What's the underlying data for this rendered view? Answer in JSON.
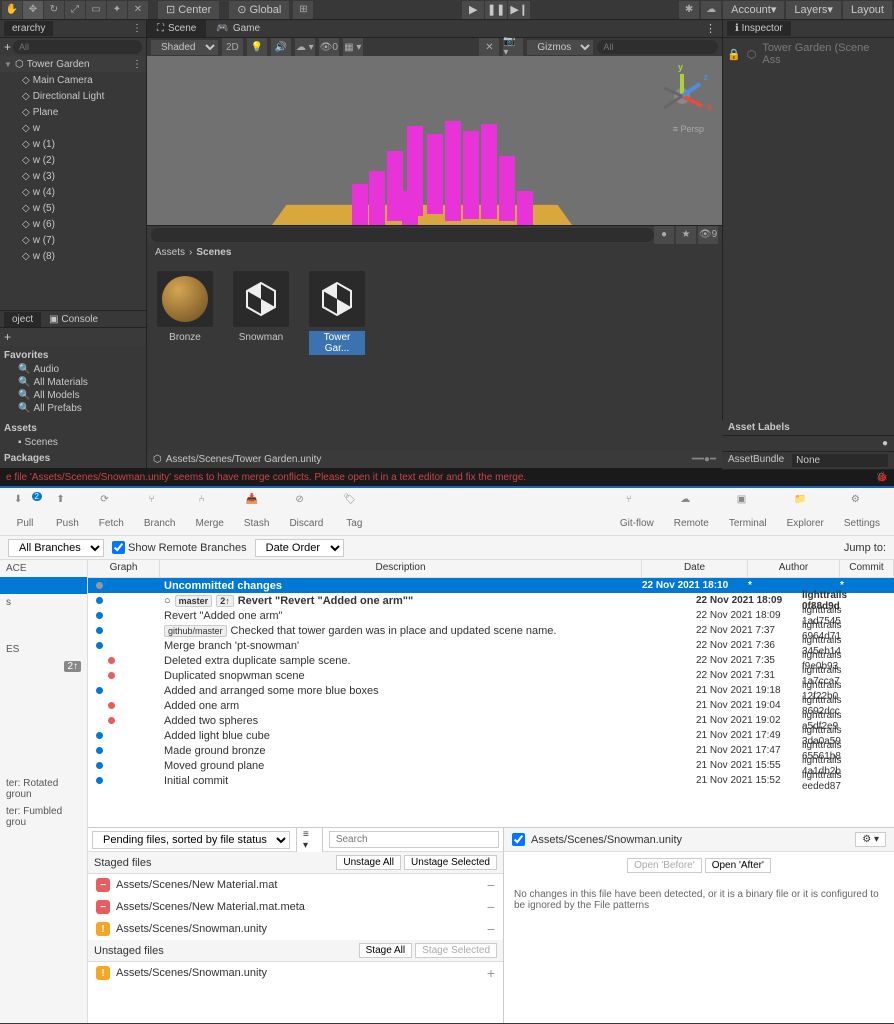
{
  "unity": {
    "toolbar": {
      "center": "Center",
      "global": "Global",
      "account": "Account",
      "layers": "Layers",
      "layout": "Layout"
    },
    "hierarchy": {
      "title": "erarchy",
      "search": "All",
      "root": "Tower Garden",
      "items": [
        "Main Camera",
        "Directional Light",
        "Plane",
        "w",
        "w (1)",
        "w (2)",
        "w (3)",
        "w (4)",
        "w (5)",
        "w (6)",
        "w (7)",
        "w (8)"
      ]
    },
    "tabs": {
      "scene": "Scene",
      "game": "Game"
    },
    "scene_toolbar": {
      "shaded": "Shaded",
      "mode2d": "2D",
      "gizmos": "Gizmos",
      "search": "All"
    },
    "gizmo": {
      "x": "x",
      "y": "y",
      "z": "z",
      "persp": "Persp"
    },
    "scene_path": "Assets/Scenes/Tower Garden.unity",
    "project": {
      "tab_project": "oject",
      "tab_console": "Console",
      "favorites": "Favorites",
      "fav_items": [
        "Audio",
        "All Materials",
        "All Models",
        "All Prefabs"
      ],
      "assets_header": "Assets",
      "scenes_item": "Scenes",
      "packages": "Packages",
      "breadcrumb_assets": "Assets",
      "breadcrumb_scenes": "Scenes",
      "counter": "9",
      "items": [
        {
          "name": "Bronze",
          "type": "material"
        },
        {
          "name": "Snowman",
          "type": "scene"
        },
        {
          "name": "Tower Gar...",
          "type": "scene",
          "selected": true
        }
      ]
    },
    "inspector": {
      "title": "Inspector",
      "asset_title": "Tower Garden (Scene Ass",
      "labels": "Asset Labels",
      "bundle": "AssetBundle",
      "bundle_val": "None"
    },
    "error": "e file 'Assets/Scenes/Snowman.unity' seems to have merge conflicts. Please open it in a text editor and fix the merge."
  },
  "sourcetree": {
    "toolbar": [
      {
        "label": "Pull",
        "badge": "2"
      },
      {
        "label": "Push"
      },
      {
        "label": "Fetch"
      },
      {
        "label": "Branch"
      },
      {
        "label": "Merge"
      },
      {
        "label": "Stash"
      },
      {
        "label": "Discard"
      },
      {
        "label": "Tag"
      }
    ],
    "toolbar_right": [
      "Git-flow",
      "Remote",
      "Terminal",
      "Explorer",
      "Settings"
    ],
    "filter": {
      "branches": "All Branches",
      "remote": "Show Remote Branches",
      "order": "Date Order",
      "jump": "Jump to:"
    },
    "sidebar": {
      "space": "ACE",
      "badge_item": "ES",
      "stash1": "ter: Rotated groun",
      "stash2": "ter: Fumbled grou"
    },
    "columns": {
      "graph": "Graph",
      "desc": "Description",
      "date": "Date",
      "author": "Author",
      "commit": "Commit"
    },
    "commits": [
      {
        "desc": "Uncommitted changes",
        "date": "22 Nov 2021 18:10",
        "author": "*",
        "commit": "*",
        "uncommitted": true
      },
      {
        "desc": "Revert \"Revert \"Added one arm\"\"",
        "tags": [
          "master",
          "2↑"
        ],
        "date": "22 Nov 2021 18:09",
        "author": "lighttrails <lightt",
        "commit": "0f88d9d",
        "bold": true,
        "head": true
      },
      {
        "desc": "Revert \"Added one arm\"",
        "date": "22 Nov 2021 18:09",
        "author": "lighttrails <lighttra",
        "commit": "1ad7545"
      },
      {
        "desc": "Checked that tower garden was in place and updated scene name.",
        "tags": [
          "github/master"
        ],
        "date": "22 Nov 2021 7:37",
        "author": "lighttrails <lighttra",
        "commit": "6964d71"
      },
      {
        "desc": "Merge branch 'pt-snowman'",
        "date": "22 Nov 2021 7:36",
        "author": "lighttrails <lighttra",
        "commit": "345eb14"
      },
      {
        "desc": "Deleted extra duplicate sample scene.",
        "date": "22 Nov 2021 7:35",
        "author": "lighttrails <lighttra",
        "commit": "f9e0b93"
      },
      {
        "desc": "Duplicated snopwman scene",
        "date": "22 Nov 2021 7:31",
        "author": "lighttrails <lighttra",
        "commit": "1a7cca7"
      },
      {
        "desc": "Added and arranged some more blue boxes",
        "date": "21 Nov 2021 19:18",
        "author": "lighttrails <lighttra",
        "commit": "12f22b0"
      },
      {
        "desc": "Added one arm",
        "date": "21 Nov 2021 19:04",
        "author": "lighttrails <lighttra",
        "commit": "8692dcc"
      },
      {
        "desc": "Added two spheres",
        "date": "21 Nov 2021 19:02",
        "author": "lighttrails <lighttra",
        "commit": "a5df2e9"
      },
      {
        "desc": "Added light blue cube",
        "date": "21 Nov 2021 17:49",
        "author": "lighttrails <lighttra",
        "commit": "3da0a59"
      },
      {
        "desc": "Made ground bronze",
        "date": "21 Nov 2021 17:47",
        "author": "lighttrails <lighttra",
        "commit": "65561b8"
      },
      {
        "desc": "Moved ground plane",
        "date": "21 Nov 2021 15:55",
        "author": "lighttrails <lighttra",
        "commit": "4a1db2b"
      },
      {
        "desc": "Initial commit",
        "date": "21 Nov 2021 15:52",
        "author": "lighttrails <lighttra",
        "commit": "eeded87"
      }
    ],
    "pending": "Pending files, sorted by file status",
    "search_placeholder": "Search",
    "staged": {
      "header": "Staged files",
      "unstage_all": "Unstage All",
      "unstage_sel": "Unstage Selected",
      "files": [
        {
          "name": "Assets/Scenes/New Material.mat",
          "icon": "removed"
        },
        {
          "name": "Assets/Scenes/New Material.mat.meta",
          "icon": "removed"
        },
        {
          "name": "Assets/Scenes/Snowman.unity",
          "icon": "warning"
        }
      ]
    },
    "unstaged": {
      "header": "Unstaged files",
      "stage_all": "Stage All",
      "stage_sel": "Stage Selected",
      "files": [
        {
          "name": "Assets/Scenes/Snowman.unity",
          "icon": "warning"
        }
      ]
    },
    "diff": {
      "file": "Assets/Scenes/Snowman.unity",
      "open_before": "Open 'Before'",
      "open_after": "Open 'After'",
      "message": "No changes in this file have been detected, or it is a binary file or it is configured to be ignored by the File patterns"
    }
  }
}
